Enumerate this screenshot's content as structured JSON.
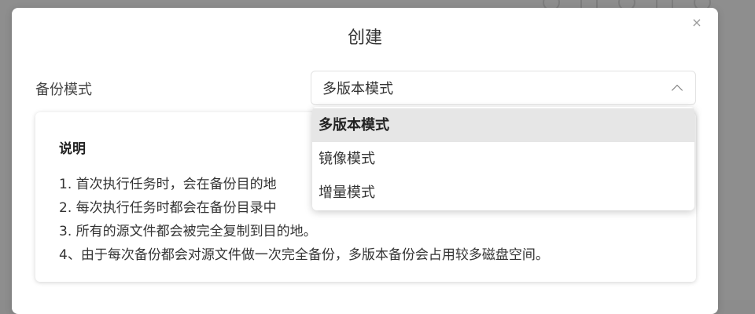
{
  "dialog": {
    "title": "创建",
    "close_glyph": "×"
  },
  "form": {
    "backup_mode_label": "备份模式",
    "backup_mode_value": "多版本模式"
  },
  "dropdown": {
    "options": [
      {
        "label": "多版本模式",
        "selected": true
      },
      {
        "label": "镜像模式",
        "selected": false
      },
      {
        "label": "增量模式",
        "selected": false
      }
    ]
  },
  "description": {
    "heading": "说明",
    "lines": [
      "1. 首次执行任务时，会在备份目的地",
      "2. 每次执行任务时都会在备份目录中",
      "3. 所有的源文件都会被完全复制到目的地。",
      "4、由于每次备份都会对源文件做一次完全备份，多版本备份会占用较多磁盘空间。"
    ]
  }
}
